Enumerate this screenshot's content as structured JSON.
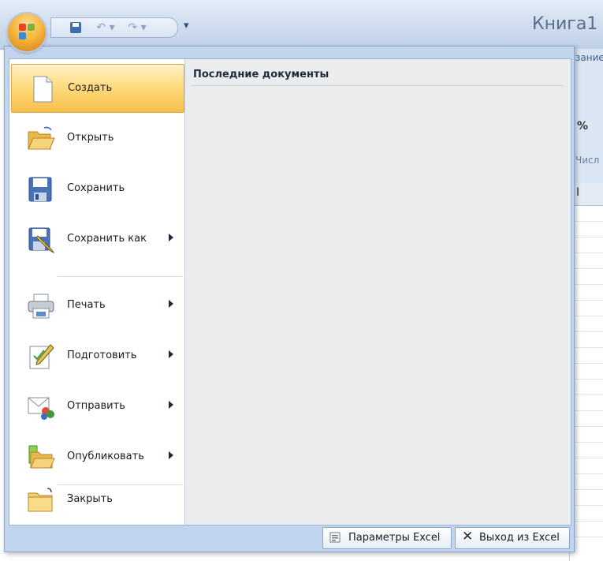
{
  "window": {
    "title": "Книга1",
    "qat": {
      "save_icon": "save-icon",
      "undo_glyph": "↶ ▾",
      "redo_glyph": "↷ ▾",
      "customize_glyph": "▾"
    }
  },
  "background_ribbon": {
    "tab_fragment": "зание",
    "percent_fragment": "%",
    "group_fragment": "Числ",
    "column_fragment": "I"
  },
  "office_menu": {
    "commands": [
      {
        "label": "Создать",
        "icon": "new-document-icon",
        "submenu": false,
        "active": true
      },
      {
        "label": "Открыть",
        "icon": "open-folder-icon",
        "submenu": false,
        "active": false
      },
      {
        "label": "Сохранить",
        "icon": "save-icon",
        "submenu": false,
        "active": false
      },
      {
        "label": "Сохранить как",
        "icon": "save-as-icon",
        "submenu": true,
        "active": false
      },
      {
        "label": "Печать",
        "icon": "printer-icon",
        "submenu": true,
        "active": false
      },
      {
        "label": "Подготовить",
        "icon": "prepare-document-icon",
        "submenu": true,
        "active": false
      },
      {
        "label": "Отправить",
        "icon": "send-icon",
        "submenu": true,
        "active": false
      },
      {
        "label": "Опубликовать",
        "icon": "publish-icon",
        "submenu": true,
        "active": false
      },
      {
        "label": "Закрыть",
        "icon": "close-folder-icon",
        "submenu": false,
        "active": false
      }
    ],
    "recent_documents_title": "Последние документы",
    "options_button": "Параметры Excel",
    "exit_button": "Выход из Excel"
  },
  "colors": {
    "accent_active": "#f7c04a",
    "menu_frame": "#c2d5ee",
    "recent_panel": "#eaeced"
  }
}
